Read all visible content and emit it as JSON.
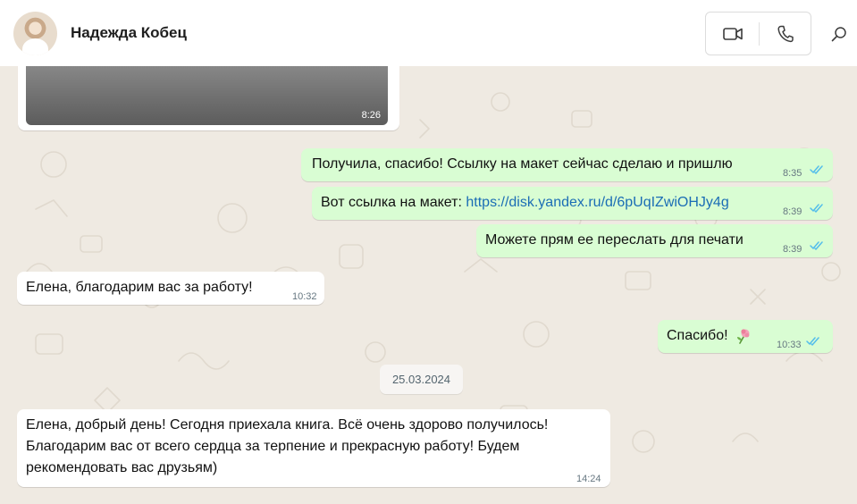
{
  "header": {
    "contact_name": "Надежда Кобец",
    "video_icon": "video-camera-icon",
    "phone_icon": "phone-icon",
    "search_icon": "search-icon"
  },
  "colors": {
    "outgoing_bubble": "#d9fdd3",
    "incoming_bubble": "#ffffff",
    "read_ticks": "#53bdeb",
    "link": "#1b6db5"
  },
  "messages": [
    {
      "id": "m0",
      "direction": "in",
      "type": "media",
      "time": "8:26"
    },
    {
      "id": "m1",
      "direction": "out",
      "text": "Получила, спасибо! Ссылку на макет сейчас сделаю и пришлю",
      "time": "8:35",
      "status": "read"
    },
    {
      "id": "m2",
      "direction": "out",
      "prefix": "Вот ссылка на макет: ",
      "link": "https://disk.yandex.ru/d/6pUqIZwiOHJy4g",
      "time": "8:39",
      "status": "read"
    },
    {
      "id": "m3",
      "direction": "out",
      "text": "Можете прям ее переслать для печати",
      "time": "8:39",
      "status": "read"
    },
    {
      "id": "m4",
      "direction": "in",
      "text": "Елена, благодарим вас за работу!",
      "time": "10:32"
    },
    {
      "id": "m5",
      "direction": "out",
      "text": "Спасибо!",
      "emoji": "flower-emoji",
      "time": "10:33",
      "status": "read"
    },
    {
      "id": "m6",
      "direction": "in",
      "lines": [
        "Елена, добрый день! Сегодня приехала книга. Всё очень здорово получилось!",
        "Благодарим вас от всего сердца за терпение и прекрасную работу! Будем",
        "рекомендовать вас друзьям)"
      ],
      "time": "14:24"
    }
  ],
  "date_separator": "25.03.2024"
}
